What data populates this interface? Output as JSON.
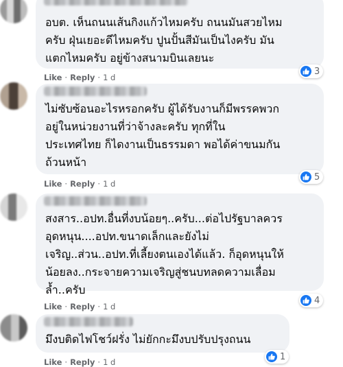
{
  "colors": {
    "bubble_bg": "#f0f2f5",
    "like_blue": "#1877f2",
    "meta_gray": "#65676b",
    "text": "#050505"
  },
  "action_labels": {
    "like": "Like",
    "reply": "Reply",
    "separator": "·"
  },
  "comments": [
    {
      "author": "",
      "text": "อบต. เห็นถนนเส้นกิงแก้วไหมครับ ถนนมันสวยไหม\nครับ ฝุ่นเยอะดีไหมครับ ปูนปั้นสีมันเป็นไงครับ มัน\nแตกไหมครับ อยู่ข้างสนามบินเลยนะ",
      "time": "1 d",
      "reaction_icon": "like-icon",
      "reaction_count": "3"
    },
    {
      "author": "",
      "text": "ไม่ซับซ้อนอะไรหรอกครับ ผู้ได้รับงานก็มีพรรคพวก\nอยู่ในหน่วยงานที่ว่าจ้างละครับ ทุกที่ใน\nประเทศไทย ก็ไดงานเป็นธรรมดา พอได้ค่าขนมกัน\nถ้วนหน้า",
      "time": "1 d",
      "reaction_icon": "like-icon",
      "reaction_count": "5"
    },
    {
      "author": "",
      "text": "สงสาร..อปท.อื่นที่งบน้อยๆ..ครับ...ต่อไปรัฐบาลควร\nอุดหนุน....อปท.ขนาดเล็กและยังไม่\nเจริญ..ส่วน..อปท.ที่เลี้ยงตนเองได้แล้ว. ก็อุดหนุนให้\nน้อยลง..กระจายความเจริญสู่ชนบทลดความเลื่อม\nล้ำ..ครับ",
      "time": "1 d",
      "reaction_icon": "like-icon",
      "reaction_count": "4"
    },
    {
      "author": "",
      "text": "มึงบติดไฟโชว์ฝรั่ง ไม่ยักกะมึงบปรับปรุงถนน",
      "time": "1 d",
      "reaction_icon": "like-icon",
      "reaction_count": "1"
    }
  ]
}
